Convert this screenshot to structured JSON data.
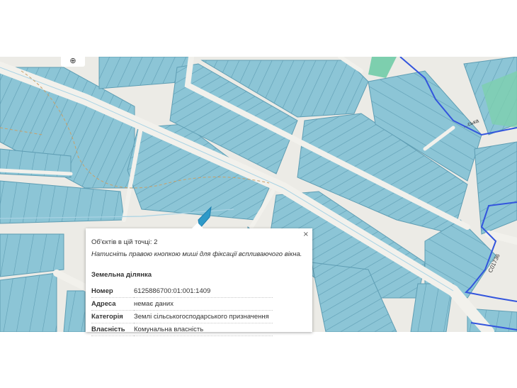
{
  "map": {
    "road_label": "C01736",
    "street_label": "...ська",
    "colors": {
      "background": "#ecebe6",
      "parcel_fill": "#8cc5d6",
      "parcel_stroke": "#5e9db3",
      "selected_parcel": "#2e9ac8",
      "boundary": "#3355dd",
      "green_zone": "#7dcfae",
      "path": "#c8a06a"
    }
  },
  "locate_button": {
    "icon": "locate-icon",
    "glyph": "⊕"
  },
  "popup": {
    "count_text": "Об'єктів в цій точці: 2",
    "hint_text": "Натисніть правою кнопкою миші для фіксації вспливаючого вікна.",
    "section_title": "Земельна ділянка",
    "close_glyph": "×",
    "rows": [
      {
        "label": "Номер",
        "value": "6125886700:01:001:1409"
      },
      {
        "label": "Адреса",
        "value": "немає даних"
      },
      {
        "label": "Категорія",
        "value": "Землі сільськогосподарського призначення"
      },
      {
        "label": "Власність",
        "value": "Комунальна власність"
      }
    ]
  }
}
